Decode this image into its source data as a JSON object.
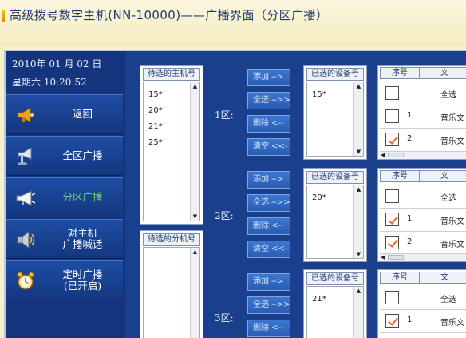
{
  "title": "高级拨号数字主机(NN-10000)——广播界面（分区广播）",
  "datetime": {
    "date": "2010年 01 月 02 日",
    "time": "星期六  10:20:52"
  },
  "nav": [
    {
      "label": "返回",
      "icon": "megaphone-icon",
      "active": false
    },
    {
      "label": "全区广播",
      "icon": "horn-speaker-icon",
      "active": false
    },
    {
      "label": "分区广播",
      "icon": "bullhorn-icon",
      "active": true
    },
    {
      "label": "对主机\n广播喊话",
      "icon": "loudspeaker-icon",
      "active": false
    },
    {
      "label": "定时广播\n(已开启)",
      "icon": "alarm-clock-icon",
      "active": false
    }
  ],
  "host_list": {
    "header": "待选的主机号",
    "items": [
      "15*",
      "20*",
      "21*",
      "25*"
    ]
  },
  "ext_list": {
    "header": "待选的分机号",
    "items": []
  },
  "buttons": {
    "add": "添加 -->",
    "add_all": "全选 -->>",
    "remove": "删除 <--",
    "clear": "清空 <<-"
  },
  "selected_header": "已选的设备号",
  "table_headers": {
    "seq": "序号",
    "text": "文"
  },
  "zones": [
    {
      "label": "1区:",
      "selected": [
        "15*"
      ],
      "rows": [
        {
          "num": "",
          "text": "全选",
          "checked": false
        },
        {
          "num": "1",
          "text": "音乐文",
          "checked": false
        },
        {
          "num": "2",
          "text": "音乐文",
          "checked": true
        }
      ]
    },
    {
      "label": "2区:",
      "selected": [
        "20*"
      ],
      "rows": [
        {
          "num": "",
          "text": "全选",
          "checked": false
        },
        {
          "num": "1",
          "text": "音乐文",
          "checked": true
        },
        {
          "num": "2",
          "text": "音乐文",
          "checked": true
        }
      ]
    },
    {
      "label": "3区:",
      "selected": [
        "21*"
      ],
      "rows": [
        {
          "num": "",
          "text": "全选",
          "checked": false
        },
        {
          "num": "1",
          "text": "音乐文",
          "checked": true
        }
      ]
    }
  ],
  "colors": {
    "accent_active": "#6bd36b",
    "panel": "#1a3f8c",
    "check": "#e8662a"
  }
}
